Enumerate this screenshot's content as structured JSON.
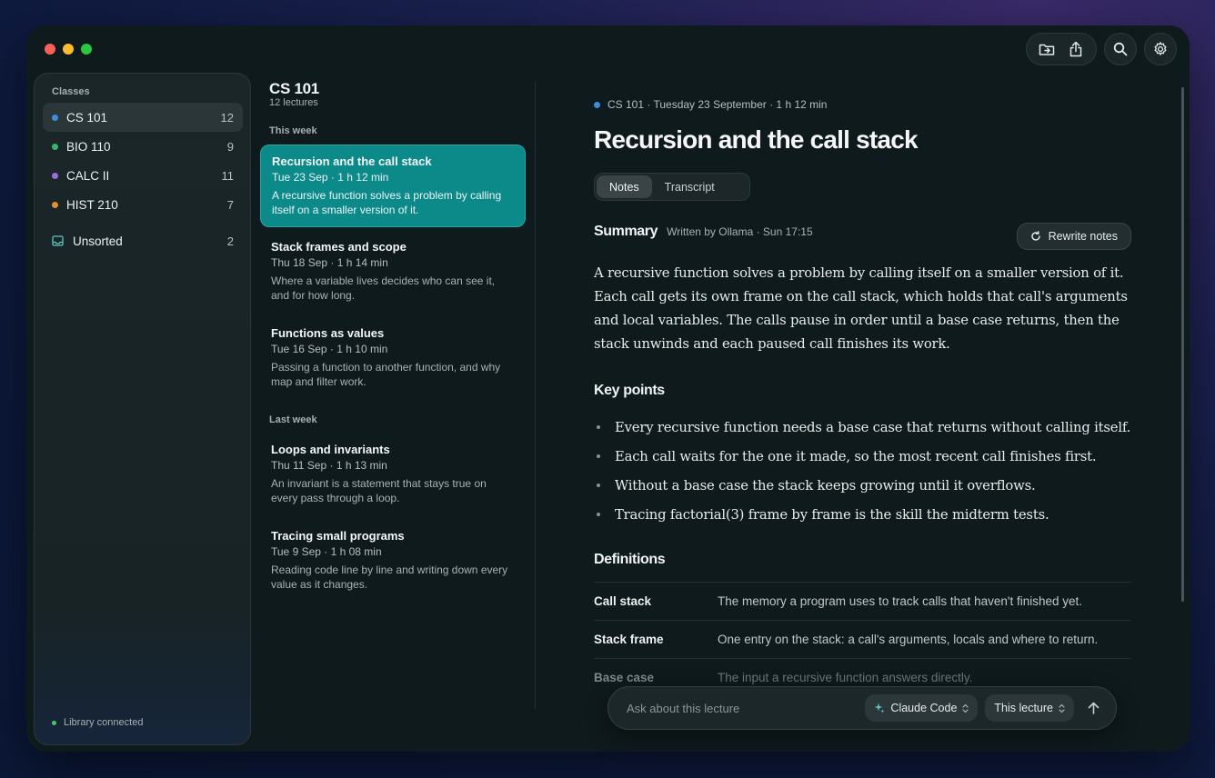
{
  "sidebar": {
    "heading": "Classes",
    "classes": [
      {
        "label": "CS 101",
        "count": "12",
        "color": "#3b8de0",
        "active": true
      },
      {
        "label": "BIO 110",
        "count": "9",
        "color": "#37b36a",
        "active": false
      },
      {
        "label": "CALC II",
        "count": "11",
        "color": "#9a6cde",
        "active": false
      },
      {
        "label": "HIST 210",
        "count": "7",
        "color": "#e0932e",
        "active": false
      }
    ],
    "unsorted": {
      "label": "Unsorted",
      "count": "2"
    },
    "status": "Library connected"
  },
  "list": {
    "title": "CS 101",
    "subtitle": "12 lectures",
    "groups": [
      {
        "label": "This week",
        "lectures": [
          {
            "title": "Recursion and the call stack",
            "meta": "Tue 23 Sep · 1 h 12 min",
            "desc": "A recursive function solves a problem by calling itself on a smaller version of it.",
            "active": true
          },
          {
            "title": "Stack frames and scope",
            "meta": "Thu 18 Sep · 1 h 14 min",
            "desc": "Where a variable lives decides who can see it, and for how long."
          },
          {
            "title": "Functions as values",
            "meta": "Tue 16 Sep · 1 h 10 min",
            "desc": "Passing a function to another function, and why map and filter work."
          }
        ]
      },
      {
        "label": "Last week",
        "lectures": [
          {
            "title": "Loops and invariants",
            "meta": "Thu 11 Sep · 1 h 13 min",
            "desc": "An invariant is a statement that stays true on every pass through a loop."
          },
          {
            "title": "Tracing small programs",
            "meta": "Tue 9 Sep · 1 h 08 min",
            "desc": "Reading code line by line and writing down every value as it changes."
          }
        ]
      }
    ]
  },
  "main": {
    "meta": "CS 101 · Tuesday 23 September · 1 h 12 min",
    "title": "Recursion and the call stack",
    "tabs": [
      {
        "label": "Notes",
        "active": true
      },
      {
        "label": "Transcript",
        "active": false
      }
    ],
    "summary_heading": "Summary",
    "summary_byline": "Written by Ollama · Sun 17:15",
    "rewrite_label": "Rewrite notes",
    "summary_text": "A recursive function solves a problem by calling itself on a smaller version of it. Each call gets its own frame on the call stack, which holds that call's arguments and local variables. The calls pause in order until a base case returns, then the stack unwinds and each paused call finishes its work.",
    "key_points_heading": "Key points",
    "key_points": [
      "Every recursive function needs a base case that returns without calling itself.",
      "Each call waits for the one it made, so the most recent call finishes first.",
      "Without a base case the stack keeps growing until it overflows.",
      "Tracing factorial(3) frame by frame is the skill the midterm tests."
    ],
    "definitions_heading": "Definitions",
    "definitions": [
      {
        "term": "Call stack",
        "desc": "The memory a program uses to track calls that haven't finished yet."
      },
      {
        "term": "Stack frame",
        "desc": "One entry on the stack: a call's arguments, locals and where to return."
      },
      {
        "term": "Base case",
        "desc": "The input a recursive function answers directly."
      }
    ]
  },
  "composer": {
    "placeholder": "Ask about this lecture",
    "model": "Claude Code",
    "scope": "This lecture"
  },
  "icons": {
    "toolbar": [
      "folder-import-icon",
      "share-icon",
      "search-icon",
      "gear-icon"
    ]
  }
}
